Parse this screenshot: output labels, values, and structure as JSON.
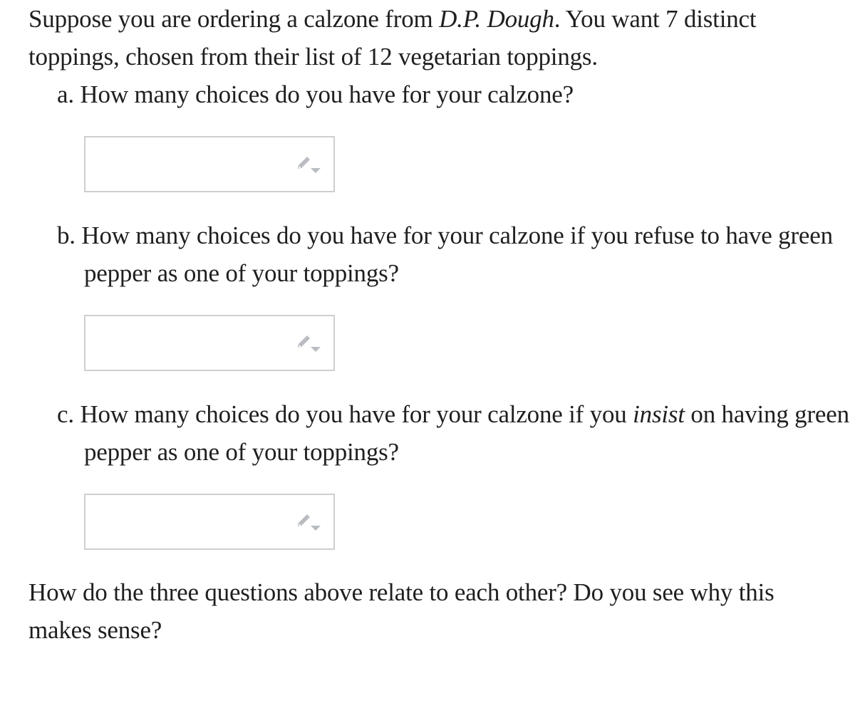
{
  "intro": {
    "before_italic": "Suppose you are ordering a calzone from ",
    "italic": "D.P. Dough",
    "after_italic": ". You want 7 distinct toppings, chosen from their list of 12 vegetarian toppings."
  },
  "questions": [
    {
      "label": "a.",
      "text": "How many choices do you have for your calzone?",
      "answer_value": "",
      "answer_icon": "pencil-dropdown-icon"
    },
    {
      "label": "b.",
      "text": "How many choices do you have for your calzone if you refuse to have green pepper as one of your toppings?",
      "answer_value": "",
      "answer_icon": "pencil-dropdown-icon"
    },
    {
      "label": "c.",
      "text_before_italic": "How many choices do you have for your calzone if you ",
      "italic": "insist",
      "text_after_italic": " on having green pepper as one of your toppings?",
      "answer_value": "",
      "answer_icon": "pencil-dropdown-icon"
    }
  ],
  "closing": "How do the three questions above relate to each other? Do you see why this makes sense?",
  "colors": {
    "text": "#1f1f1f",
    "box_border": "#cfcfcf",
    "icon": "#b9bcc0"
  }
}
